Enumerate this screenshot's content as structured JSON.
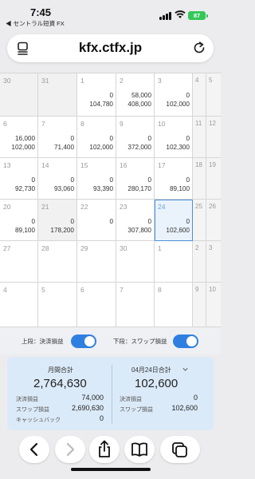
{
  "status_bar": {
    "time": "7:45",
    "back_app": "◀ セントラル短資 FX",
    "battery": "87"
  },
  "url_bar": {
    "domain": "kfx.ctfx.jp"
  },
  "calendar": {
    "rows": [
      [
        {
          "day": "30",
          "v1": "",
          "v2": "",
          "state": "muted"
        },
        {
          "day": "31",
          "v1": "",
          "v2": "",
          "state": "muted"
        },
        {
          "day": "1",
          "v1": "0",
          "v2": "104,780",
          "state": ""
        },
        {
          "day": "2",
          "v1": "58,000",
          "v2": "408,000",
          "state": ""
        },
        {
          "day": "3",
          "v1": "0",
          "v2": "102,000",
          "state": ""
        },
        {
          "day": "4",
          "v1": "",
          "v2": "",
          "state": "sat"
        },
        {
          "day": "5",
          "v1": "",
          "v2": "",
          "state": "sun"
        }
      ],
      [
        {
          "day": "6",
          "v1": "16,000",
          "v2": "102,000",
          "state": ""
        },
        {
          "day": "7",
          "v1": "0",
          "v2": "71,400",
          "state": ""
        },
        {
          "day": "8",
          "v1": "0",
          "v2": "102,000",
          "state": ""
        },
        {
          "day": "9",
          "v1": "0",
          "v2": "372,000",
          "state": ""
        },
        {
          "day": "10",
          "v1": "0",
          "v2": "102,300",
          "state": ""
        },
        {
          "day": "11",
          "v1": "",
          "v2": "",
          "state": "sat"
        },
        {
          "day": "12",
          "v1": "",
          "v2": "",
          "state": "sun"
        }
      ],
      [
        {
          "day": "13",
          "v1": "0",
          "v2": "92,730",
          "state": ""
        },
        {
          "day": "14",
          "v1": "0",
          "v2": "93,060",
          "state": ""
        },
        {
          "day": "15",
          "v1": "0",
          "v2": "93,390",
          "state": ""
        },
        {
          "day": "16",
          "v1": "0",
          "v2": "280,170",
          "state": ""
        },
        {
          "day": "17",
          "v1": "0",
          "v2": "89,100",
          "state": ""
        },
        {
          "day": "18",
          "v1": "",
          "v2": "",
          "state": "sat"
        },
        {
          "day": "19",
          "v1": "",
          "v2": "",
          "state": "sun"
        }
      ],
      [
        {
          "day": "20",
          "v1": "0",
          "v2": "89,100",
          "state": ""
        },
        {
          "day": "21",
          "v1": "0",
          "v2": "178,200",
          "state": "muted"
        },
        {
          "day": "22",
          "v1": "0",
          "v2": "",
          "state": ""
        },
        {
          "day": "23",
          "v1": "0",
          "v2": "307,800",
          "state": ""
        },
        {
          "day": "24",
          "v1": "0",
          "v2": "102,600",
          "state": "selected"
        },
        {
          "day": "25",
          "v1": "",
          "v2": "",
          "state": "sat"
        },
        {
          "day": "26",
          "v1": "",
          "v2": "",
          "state": "sun"
        }
      ],
      [
        {
          "day": "27",
          "v1": "",
          "v2": "",
          "state": ""
        },
        {
          "day": "28",
          "v1": "",
          "v2": "",
          "state": ""
        },
        {
          "day": "29",
          "v1": "",
          "v2": "",
          "state": ""
        },
        {
          "day": "30",
          "v1": "",
          "v2": "",
          "state": ""
        },
        {
          "day": "1",
          "v1": "",
          "v2": "",
          "state": ""
        },
        {
          "day": "2",
          "v1": "",
          "v2": "",
          "state": "sat"
        },
        {
          "day": "3",
          "v1": "",
          "v2": "",
          "state": "sun"
        }
      ],
      [
        {
          "day": "4",
          "v1": "",
          "v2": "",
          "state": ""
        },
        {
          "day": "5",
          "v1": "",
          "v2": "",
          "state": ""
        },
        {
          "day": "6",
          "v1": "",
          "v2": "",
          "state": ""
        },
        {
          "day": "7",
          "v1": "",
          "v2": "",
          "state": ""
        },
        {
          "day": "8",
          "v1": "",
          "v2": "",
          "state": ""
        },
        {
          "day": "9",
          "v1": "",
          "v2": "",
          "state": "sat"
        },
        {
          "day": "10",
          "v1": "",
          "v2": "",
          "state": "sun"
        }
      ]
    ]
  },
  "toggles": {
    "upper_label": "上段：決済損益",
    "upper_on": true,
    "lower_label": "下段：スワップ損益",
    "lower_on": true
  },
  "summary": {
    "monthly": {
      "title": "月間合計",
      "total": "2,764,630",
      "rows": [
        {
          "label": "決済損益",
          "value": "74,000"
        },
        {
          "label": "スワップ損益",
          "value": "2,690,630"
        },
        {
          "label": "キャッシュバック",
          "value": "0"
        }
      ]
    },
    "daily": {
      "title": "04月24日合計",
      "total": "102,600",
      "rows": [
        {
          "label": "決済損益",
          "value": "0"
        },
        {
          "label": "スワップ損益",
          "value": "102,600"
        }
      ]
    }
  },
  "colors": {
    "accent": "#2f7fe0",
    "summary_bg": "#dbeaf8",
    "selected_border": "#4a90d9"
  },
  "icons": [
    "tabs-menu-icon",
    "reload-icon",
    "back-icon",
    "forward-icon",
    "share-icon",
    "bookmarks-icon",
    "tabs-icon"
  ]
}
